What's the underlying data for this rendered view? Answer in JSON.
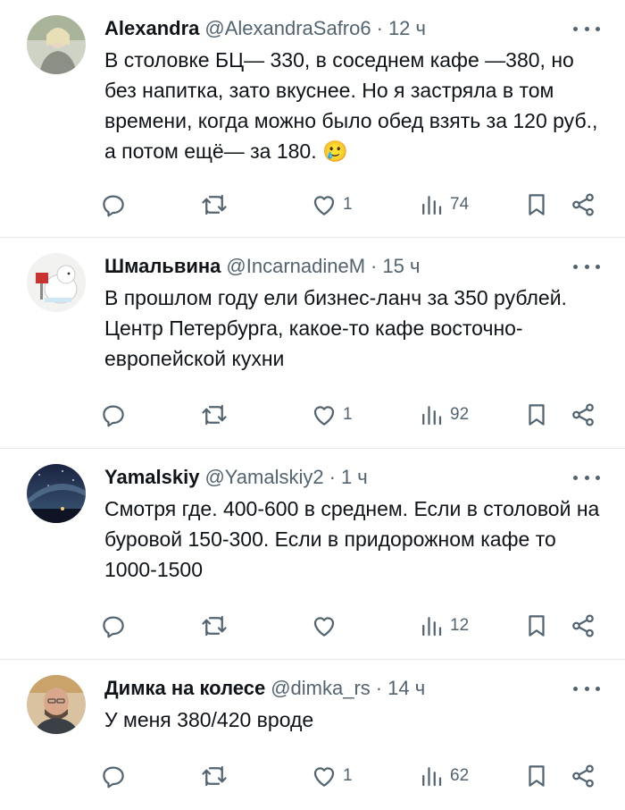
{
  "tweets": [
    {
      "name": "Alexandra",
      "handle": "@AlexandraSafro6",
      "sep": "·",
      "time": "12 ч",
      "text": "В столовке БЦ— 330, в соседнем кафе —380, но без напитка, зато вкуснее. Но я застряла в том времени, когда можно было обед взять за 120 руб., а потом ещё— за 180.",
      "emoji": "🥲",
      "likes": "1",
      "views": "74"
    },
    {
      "name": "Шмальвина",
      "handle": "@IncarnadineM",
      "sep": "·",
      "time": "15 ч",
      "text": "В прошлом году ели бизнес-ланч за 350 рублей. Центр Петербурга, какое-то кафе восточно-европейской кухни",
      "likes": "1",
      "views": "92"
    },
    {
      "name": "Yamalskiy",
      "handle": "@Yamalskiy2",
      "sep": "·",
      "time": "1 ч",
      "text": "Смотря где. 400-600 в среднем. Если в столовой на буровой 150-300. Если в придорожном кафе то 1000-1500",
      "likes": "",
      "views": "12"
    },
    {
      "name": "Димка на колесе",
      "handle": "@dimka_rs",
      "sep": "·",
      "time": "14 ч",
      "text": "У меня 380/420 вроде",
      "likes": "1",
      "views": "62"
    }
  ],
  "icons": {
    "reply": "reply-icon",
    "retweet": "retweet-icon",
    "like": "heart-icon",
    "views": "views-icon",
    "bookmark": "bookmark-icon",
    "share": "share-icon",
    "more": "more-icon"
  },
  "colors": {
    "text": "#0f1419",
    "muted": "#536471",
    "divider": "#e6e9ec"
  }
}
